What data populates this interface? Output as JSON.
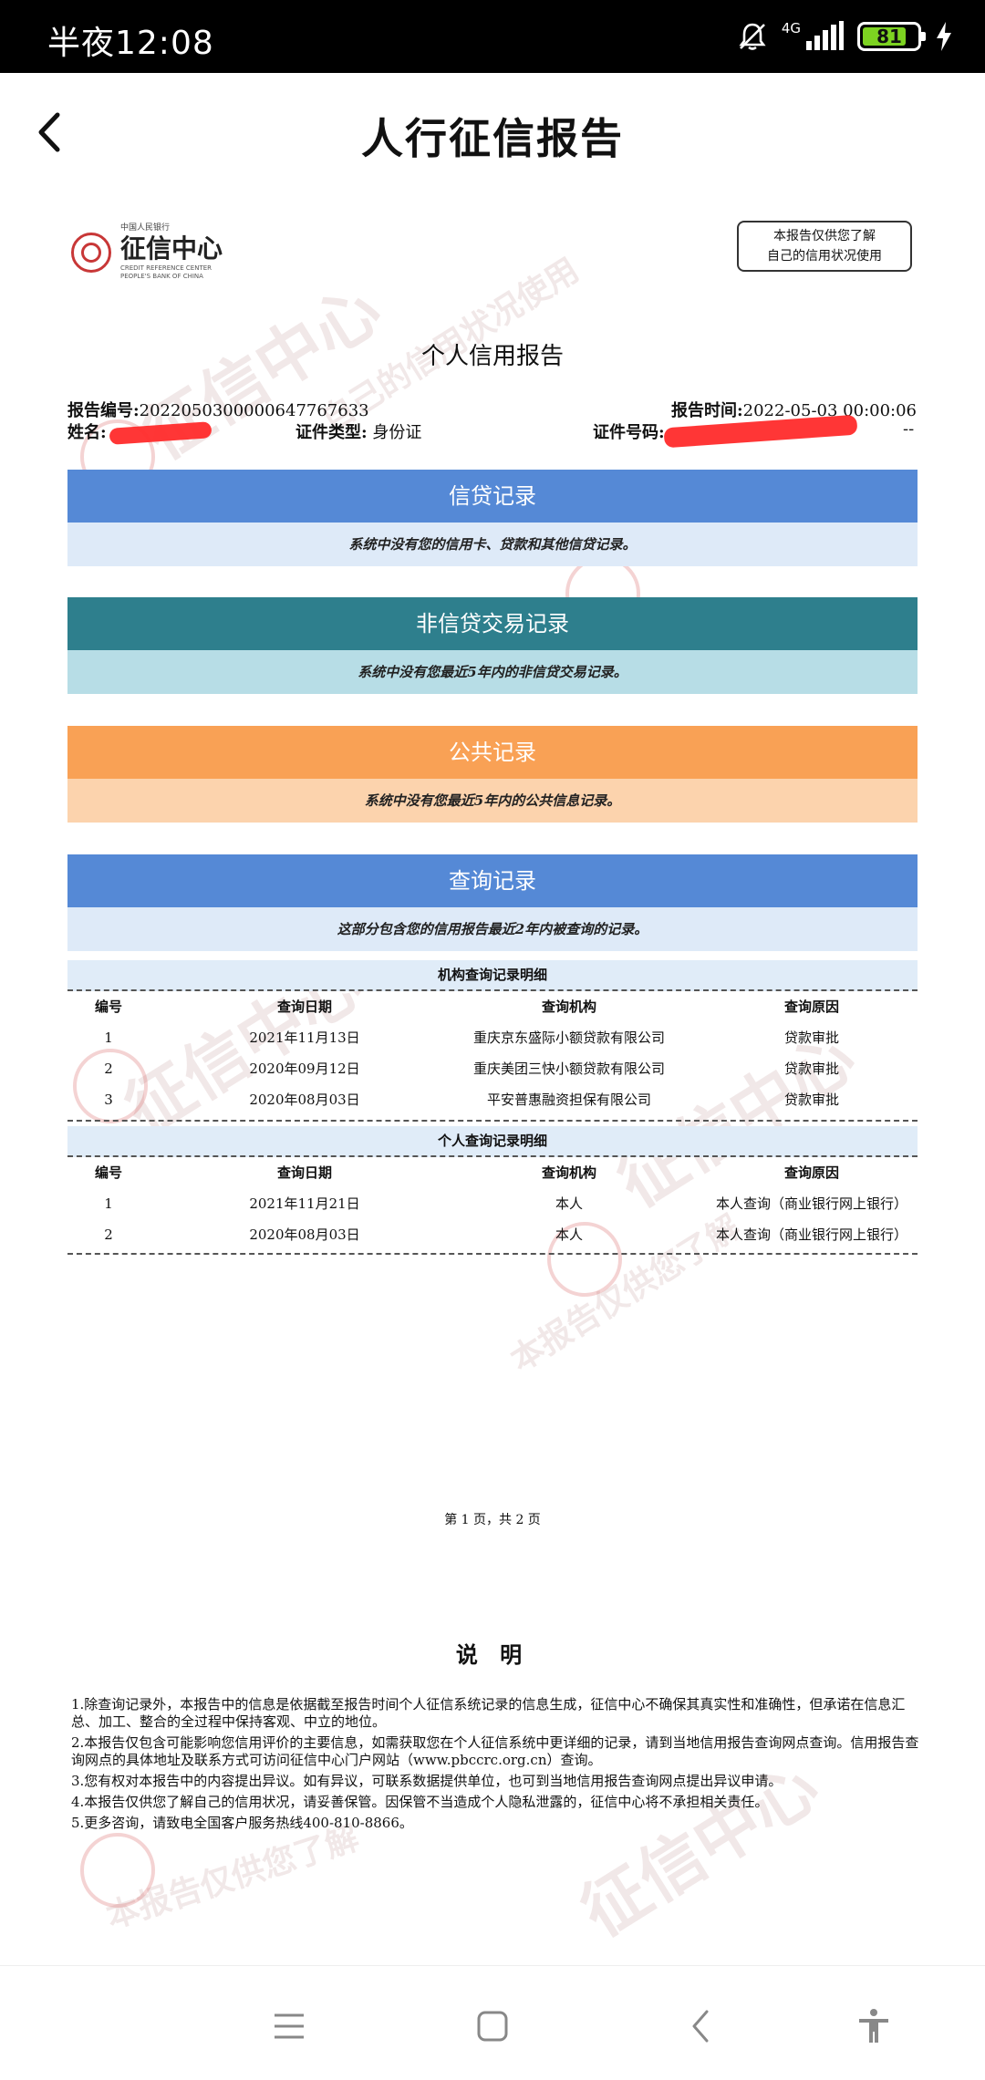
{
  "status_bar": {
    "time": "半夜12:08",
    "network": "4G",
    "battery_level": "81",
    "battery_percent": 81,
    "icons": [
      "mute-icon",
      "signal-icon",
      "battery-icon",
      "charging-icon"
    ]
  },
  "app_bar": {
    "title": "人行征信报告",
    "back_icon": "chevron-left-icon"
  },
  "report": {
    "logo": {
      "small": "中国人民银行",
      "main": "征信中心",
      "en_line1": "CREDIT REFERENCE CENTER",
      "en_line2": "PEOPLE'S BANK OF CHINA"
    },
    "stamp_line1": "本报告仅供您了解",
    "stamp_line2": "自己的信用状况使用",
    "title": "个人信用报告",
    "report_no_label": "报告编号:",
    "report_no": "2022050300000647767633",
    "report_time_label": "报告时间:",
    "report_time": "2022-05-03 00:00:06",
    "name_label": "姓名:",
    "id_type_label": "证件类型:",
    "id_type": "身份证",
    "id_no_label": "证件号码:",
    "id_no_tail": "--",
    "sections": {
      "credit": {
        "title": "信贷记录",
        "body": "系统中没有您的信用卡、贷款和其他信贷记录。",
        "head_color": "#5589d6",
        "body_color": "#deeaf8"
      },
      "noncredit": {
        "title": "非信贷交易记录",
        "body": "系统中没有您最近5年内的非信贷交易记录。",
        "head_color": "#2e7f8d",
        "body_color": "#b7dde6"
      },
      "public": {
        "title": "公共记录",
        "body": "系统中没有您最近5年内的公共信息记录。",
        "head_color": "#f9a155",
        "body_color": "#fcd3ad"
      },
      "query": {
        "title": "查询记录",
        "body": "这部分包含您的信用报告最近2年内被查询的记录。",
        "head_color": "#5589d6",
        "body_color": "#deeaf8"
      }
    },
    "institution_queries": {
      "title": "机构查询记录明细",
      "columns": [
        "编号",
        "查询日期",
        "查询机构",
        "查询原因"
      ],
      "rows": [
        [
          "1",
          "2021年11月13日",
          "重庆京东盛际小额贷款有限公司",
          "贷款审批"
        ],
        [
          "2",
          "2020年09月12日",
          "重庆美团三快小额贷款有限公司",
          "贷款审批"
        ],
        [
          "3",
          "2020年08月03日",
          "平安普惠融资担保有限公司",
          "贷款审批"
        ]
      ]
    },
    "personal_queries": {
      "title": "个人查询记录明细",
      "columns": [
        "编号",
        "查询日期",
        "查询机构",
        "查询原因"
      ],
      "rows": [
        [
          "1",
          "2021年11月21日",
          "本人",
          "本人查询（商业银行网上银行）"
        ],
        [
          "2",
          "2020年08月03日",
          "本人",
          "本人查询（商业银行网上银行）"
        ]
      ]
    },
    "page_number": "第 1 页，共 2 页",
    "notes_title": "说 明",
    "notes": [
      "1.除查询记录外，本报告中的信息是依据截至报告时间个人征信系统记录的信息生成，征信中心不确保其真实性和准确性，但承诺在信息汇总、加工、整合的全过程中保持客观、中立的地位。",
      "2.本报告仅包含可能影响您信用评价的主要信息，如需获取您在个人征信系统中更详细的记录，请到当地信用报告查询网点查询。信用报告查询网点的具体地址及联系方式可访问征信中心门户网站（www.pbccrc.org.cn）查询。",
      "3.您有权对本报告中的内容提出异议。如有异议，可联系数据提供单位，也可到当地信用报告查询网点提出异议申请。",
      "4.本报告仅供您了解自己的信用状况，请妥善保管。因保管不当造成个人隐私泄露的，征信中心将不承担相关责任。",
      "5.更多咨询，请致电全国客户服务热线400-810-8866。"
    ]
  },
  "nav_bar": {
    "icons": [
      "menu-icon",
      "home-square-icon",
      "back-chevron-icon",
      "accessibility-icon"
    ]
  }
}
